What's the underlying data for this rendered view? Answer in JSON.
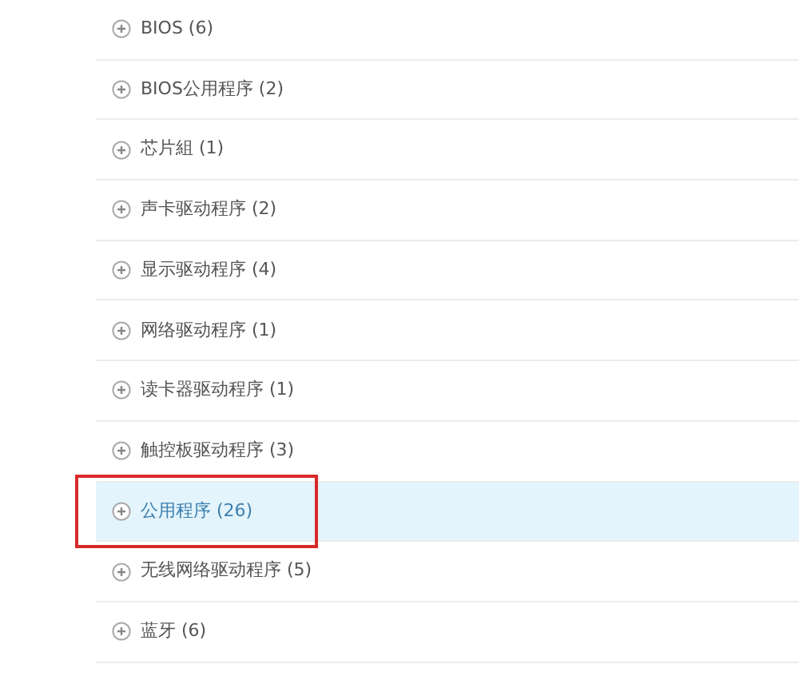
{
  "categories": [
    {
      "label": "BIOS (6)",
      "selected": false
    },
    {
      "label": "BIOS公用程序 (2)",
      "selected": false
    },
    {
      "label": "芯片組 (1)",
      "selected": false
    },
    {
      "label": "声卡驱动程序 (2)",
      "selected": false
    },
    {
      "label": "显示驱动程序 (4)",
      "selected": false
    },
    {
      "label": "网络驱动程序 (1)",
      "selected": false
    },
    {
      "label": "读卡器驱动程序 (1)",
      "selected": false
    },
    {
      "label": "触控板驱动程序 (3)",
      "selected": false
    },
    {
      "label": "公用程序 (26)",
      "selected": true
    },
    {
      "label": "无线网络驱动程序 (5)",
      "selected": false
    },
    {
      "label": "蓝牙 (6)",
      "selected": false
    }
  ]
}
